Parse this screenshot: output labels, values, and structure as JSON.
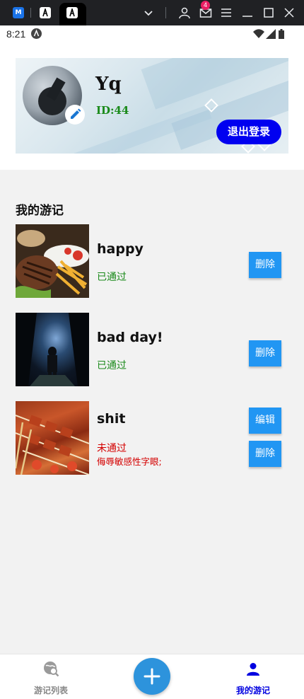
{
  "statusbar": {
    "time": "8:21"
  },
  "chrome": {
    "notification_count": "4"
  },
  "profile": {
    "username": "Yq",
    "user_id": "ID:44",
    "logout_label": "退出登录"
  },
  "section": {
    "title": "我的游记"
  },
  "notes": [
    {
      "title": "happy",
      "status": "已通过",
      "reason": "",
      "actions": [
        "删除"
      ]
    },
    {
      "title": "bad day!",
      "status": "已通过",
      "reason": "",
      "actions": [
        "删除"
      ]
    },
    {
      "title": "shit",
      "status": "未通过",
      "reason": "侮辱敏感性字眼;",
      "actions": [
        "编辑",
        "删除"
      ]
    }
  ],
  "nav": {
    "left_label": "游记列表",
    "right_label": "我的游记"
  },
  "colors": {
    "accent_blue": "#2196f3",
    "logout_blue": "#0000f0",
    "approved_green": "#1a8a1a",
    "rejected_red": "#d40000",
    "active_nav": "#0000e0",
    "fab": "#2d93dc"
  },
  "icons": {
    "edit": "pencil-icon",
    "nav_left": "globe-search-icon",
    "nav_right": "person-icon",
    "fab": "plus-icon"
  }
}
